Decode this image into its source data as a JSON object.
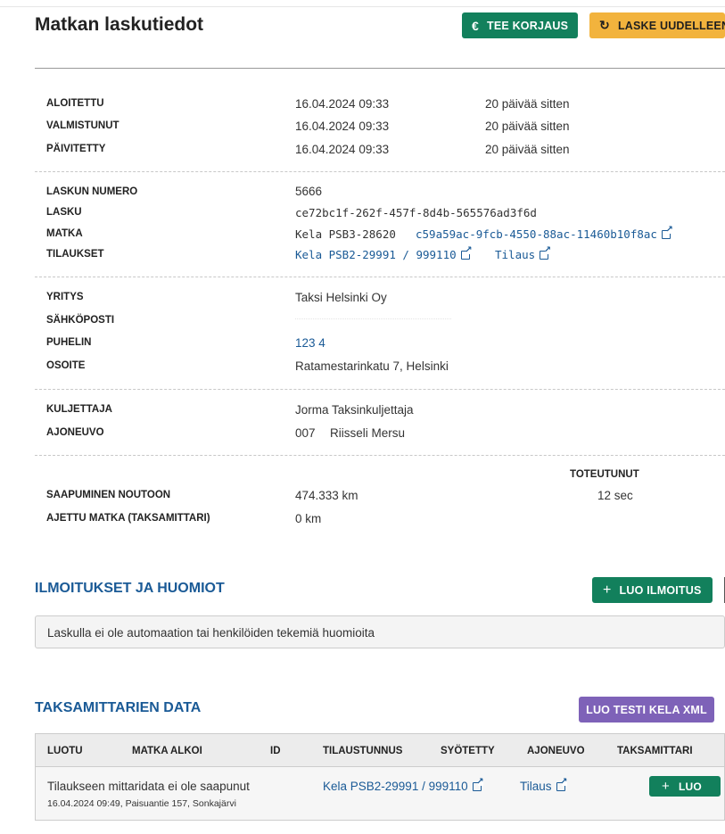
{
  "page": {
    "title": "Matkan laskutiedot",
    "buttons": {
      "correction": "TEE KORJAUS",
      "recalculate": "LASKE UUDELLEEN"
    }
  },
  "times": [
    {
      "label": "ALOITETTU",
      "value": "16.04.2024 09:33",
      "relative": "20 päivää sitten"
    },
    {
      "label": "VALMISTUNUT",
      "value": "16.04.2024 09:33",
      "relative": "20 päivää sitten"
    },
    {
      "label": "PÄIVITETTY",
      "value": "16.04.2024 09:33",
      "relative": "20 päivää sitten"
    }
  ],
  "invoice": {
    "number_label": "LASKUN NUMERO",
    "number": "5666",
    "invoice_label": "LASKU",
    "invoice_id": "ce72bc1f-262f-457f-8d4b-565576ad3f6d",
    "trip_label": "MATKA",
    "trip_code": "Kela PSB3-28620",
    "trip_link": "c59a59ac-9fcb-4550-88ac-11460b10f8ac",
    "orders_label": "TILAUKSET",
    "order_link": "Kela PSB2-29991 / 999110",
    "order_tilaus": "Tilaus"
  },
  "company": {
    "company_label": "YRITYS",
    "company": "Taksi Helsinki Oy",
    "email_label": "SÄHKÖPOSTI",
    "phone_label": "PUHELIN",
    "phone": "123 4",
    "address_label": "OSOITE",
    "address": "Ratamestarinkatu 7, Helsinki"
  },
  "driver": {
    "driver_label": "KULJETTAJA",
    "driver": "Jorma Taksinkuljettaja",
    "vehicle_label": "AJONEUVO",
    "vehicle_no": "007",
    "vehicle_name": "Riisseli Mersu"
  },
  "realized": {
    "header": "TOTEUTUNUT",
    "arrival_label": "SAAPUMINEN NOUTOON",
    "arrival_distance": "474.333 km",
    "arrival_time": "12 sec",
    "driven_label": "AJETTU MATKA (TAKSAMITTARI)",
    "driven_distance": "0 km"
  },
  "notices": {
    "title": "ILMOITUKSET JA HUOMIOT",
    "create_button": "LUO ILMOITUS",
    "empty_text": "Laskulla ei ole automaation tai henkilöiden tekemiä huomioita"
  },
  "meter": {
    "title": "TAKSAMITTARIEN DATA",
    "test_button": "LUO TESTI KELA XML",
    "columns": [
      "LUOTU",
      "MATKA ALKOI",
      "ID",
      "TILAUSTUNNUS",
      "SYÖTETTY",
      "AJONEUVO",
      "TAKSAMITTARI"
    ],
    "row": {
      "status": "Tilaukseen mittaridata ei ole saapunut",
      "detail": "16.04.2024 09:49, Paisuantie 157, Sonkajärvi",
      "order_link": "Kela PSB2-29991 / 999110",
      "tilaus": "Tilaus",
      "create_button": "LUO"
    }
  },
  "colors": {
    "green": "#12805c",
    "orange": "#f2b33d",
    "purple": "#7e62b8",
    "link": "#1a5a96"
  }
}
